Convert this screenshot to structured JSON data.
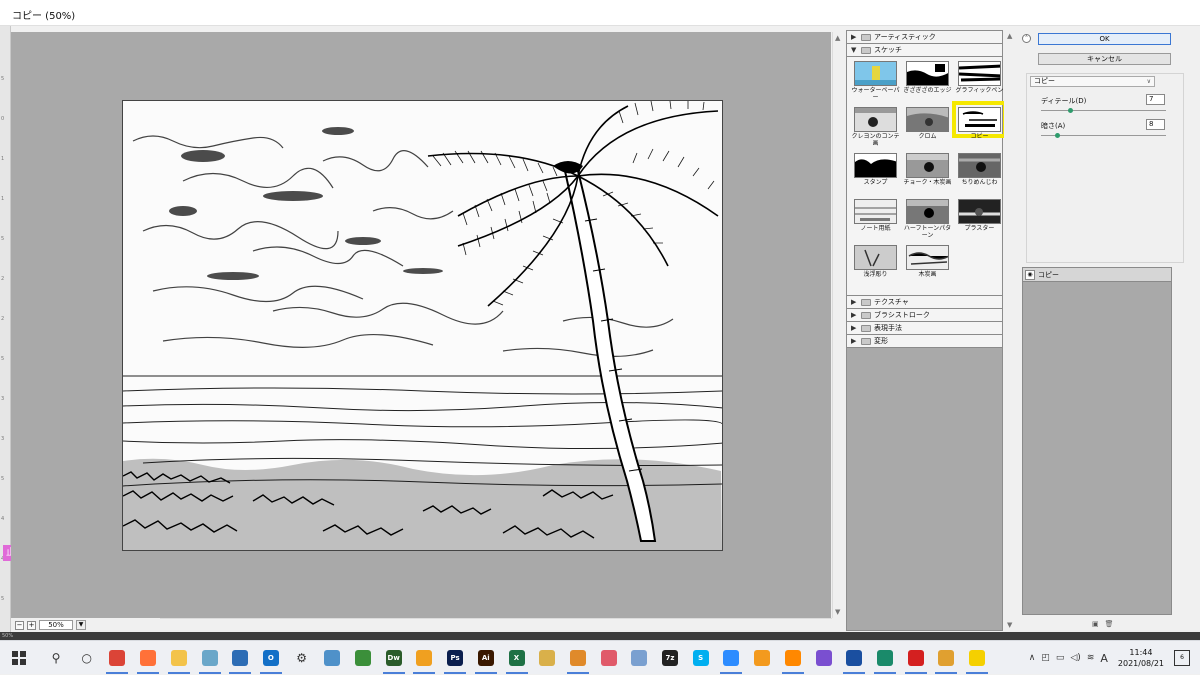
{
  "window": {
    "title": "コピー (50%)"
  },
  "preview": {
    "zoom_value": "50%",
    "status_text": "50%"
  },
  "side_stamp": "止",
  "ruler": {
    "ticks": [
      "5",
      "0",
      "1",
      "1",
      "5",
      "2",
      "2",
      "5",
      "3",
      "3",
      "5",
      "4",
      "4",
      "5"
    ]
  },
  "gallery": {
    "categories_top": [
      {
        "label": "アーティスティック",
        "expanded": false
      },
      {
        "label": "スケッチ",
        "expanded": true
      }
    ],
    "filters": [
      {
        "label": "ウォーターペーパー",
        "thumb": "water"
      },
      {
        "label": "ぎざぎざのエッジ",
        "thumb": "torn"
      },
      {
        "label": "グラフィックペン",
        "thumb": "pen"
      },
      {
        "label": "クレヨンのコンテ画",
        "thumb": "crayon"
      },
      {
        "label": "クロム",
        "thumb": "chrome"
      },
      {
        "label": "コピー",
        "thumb": "photocopy",
        "selected": true
      },
      {
        "label": "スタンプ",
        "thumb": "stamp"
      },
      {
        "label": "チョーク・木炭画",
        "thumb": "chalk"
      },
      {
        "label": "ちりめんじわ",
        "thumb": "reticulation"
      },
      {
        "label": "ノート用紙",
        "thumb": "note"
      },
      {
        "label": "ハーフトーンパターン",
        "thumb": "halftone"
      },
      {
        "label": "プラスター",
        "thumb": "plaster"
      },
      {
        "label": "浅浮彫り",
        "thumb": "bas"
      },
      {
        "label": "木炭画",
        "thumb": "charcoal"
      }
    ],
    "categories_bottom": [
      {
        "label": "テクスチャ"
      },
      {
        "label": "ブラシストローク"
      },
      {
        "label": "表現手法"
      },
      {
        "label": "変形"
      }
    ]
  },
  "settings": {
    "ok_label": "OK",
    "cancel_label": "キャンセル",
    "filter_select": "コピー",
    "detail_label": "ディテール(D)",
    "detail_value": "7",
    "detail_level": 0.23,
    "darkness_label": "暗さ(A)",
    "darkness_value": "8",
    "darkness_level": 0.13,
    "layer_name": "コピー"
  },
  "taskbar": {
    "clock_time": "11:44",
    "clock_date": "2021/08/21",
    "ime_label": "A",
    "notification_count": "6",
    "apps": [
      {
        "name": "search",
        "glyph": "⚲",
        "color": "#eef0f4"
      },
      {
        "name": "cortana",
        "glyph": "○",
        "color": "#eef0f4"
      },
      {
        "name": "chrome",
        "glyph": "",
        "color": "#db4437"
      },
      {
        "name": "firefox",
        "glyph": "",
        "color": "#ff7139"
      },
      {
        "name": "explorer",
        "glyph": "",
        "color": "#f3c34a"
      },
      {
        "name": "app-blue-1",
        "glyph": "",
        "color": "#6aa7c9"
      },
      {
        "name": "photos",
        "glyph": "",
        "color": "#2d6db5"
      },
      {
        "name": "outlook",
        "glyph": "O",
        "color": "#1370c7"
      },
      {
        "name": "settings",
        "glyph": "⚙",
        "color": "#eef0f4"
      },
      {
        "name": "app-card",
        "glyph": "",
        "color": "#4f91c9"
      },
      {
        "name": "app-green",
        "glyph": "",
        "color": "#3b8f3a"
      },
      {
        "name": "dreamweaver",
        "glyph": "Dw",
        "color": "#2b5c2b"
      },
      {
        "name": "app-orange",
        "glyph": "",
        "color": "#f0a020"
      },
      {
        "name": "photoshop",
        "glyph": "Ps",
        "color": "#0b1f4f"
      },
      {
        "name": "illustrator",
        "glyph": "Ai",
        "color": "#3a1800"
      },
      {
        "name": "excel",
        "glyph": "X",
        "color": "#1e7145"
      },
      {
        "name": "app-pen",
        "glyph": "",
        "color": "#d9b04a"
      },
      {
        "name": "app-butterfly",
        "glyph": "",
        "color": "#e08a2a"
      },
      {
        "name": "app-snip",
        "glyph": "",
        "color": "#e05a6a"
      },
      {
        "name": "app-paint",
        "glyph": "",
        "color": "#7aa0d0"
      },
      {
        "name": "7zip",
        "glyph": "7z",
        "color": "#222222"
      },
      {
        "name": "skype",
        "glyph": "S",
        "color": "#00aff0"
      },
      {
        "name": "zoom",
        "glyph": "",
        "color": "#2d8cff"
      },
      {
        "name": "app-media",
        "glyph": "",
        "color": "#f39a1e"
      },
      {
        "name": "vlc",
        "glyph": "",
        "color": "#ff8800"
      },
      {
        "name": "app-purple",
        "glyph": "",
        "color": "#7a4fd0"
      },
      {
        "name": "app-music",
        "glyph": "",
        "color": "#1a4fa0"
      },
      {
        "name": "app-circle",
        "glyph": "",
        "color": "#1a8a6a"
      },
      {
        "name": "app-record",
        "glyph": "",
        "color": "#d42020"
      },
      {
        "name": "app-dog",
        "glyph": "",
        "color": "#e0a030"
      },
      {
        "name": "app-sticky",
        "glyph": "",
        "color": "#f5d000"
      }
    ]
  }
}
